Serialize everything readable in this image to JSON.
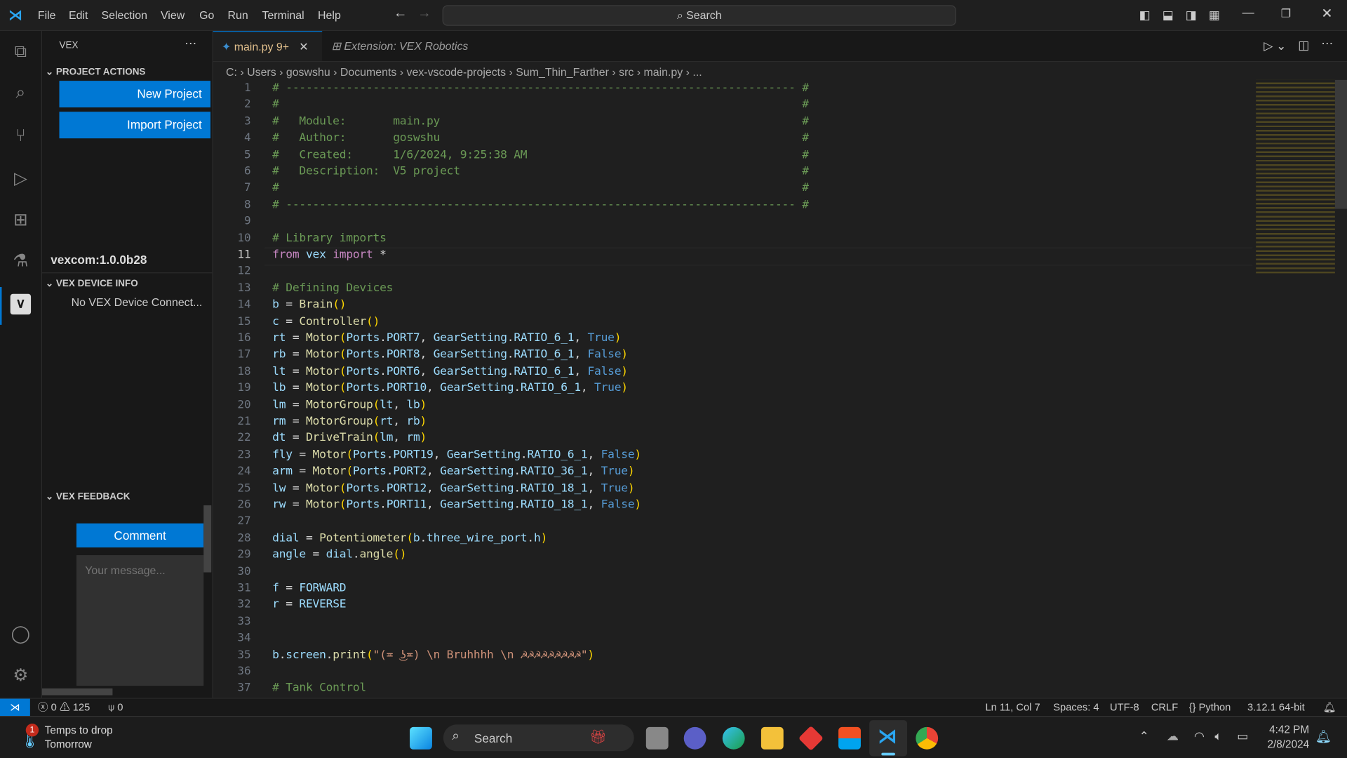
{
  "menu": [
    "File",
    "Edit",
    "Selection",
    "View",
    "Go",
    "Run",
    "Terminal",
    "Help"
  ],
  "search_label": "Search",
  "sidebar": {
    "title": "VEX",
    "project_actions": "PROJECT ACTIONS",
    "new_project": "New Project",
    "import_project": "Import Project",
    "version": "vexcom:1.0.0b28",
    "device_info": "VEX DEVICE INFO",
    "no_device": "No VEX Device Connect...",
    "feedback": "VEX FEEDBACK",
    "comment": "Comment",
    "message_placeholder": "Your message..."
  },
  "tabs": [
    {
      "label": "main.py",
      "badge": "9+"
    },
    {
      "label": "Extension: VEX Robotics"
    }
  ],
  "breadcrumb": [
    "C:",
    "Users",
    "goswshu",
    "Documents",
    "vex-vscode-projects",
    "Sum_Thin_Farther",
    "src",
    "main.py",
    "..."
  ],
  "code": [
    "# ---------------------------------------------------------------------------- #",
    "#                                                                              #",
    "#   Module:       main.py                                                      #",
    "#   Author:       goswshu                                                      #",
    "#   Created:      1/6/2024, 9:25:38 AM                                         #",
    "#   Description:  V5 project                                                   #",
    "#                                                                              #",
    "# ---------------------------------------------------------------------------- #",
    "",
    "# Library imports",
    "from vex import *",
    "",
    "# Defining Devices",
    "b = Brain()",
    "c = Controller()",
    "rt = Motor(Ports.PORT7, GearSetting.RATIO_6_1, True)",
    "rb = Motor(Ports.PORT8, GearSetting.RATIO_6_1, False)",
    "lt = Motor(Ports.PORT6, GearSetting.RATIO_6_1, False)",
    "lb = Motor(Ports.PORT10, GearSetting.RATIO_6_1, True)",
    "lm = MotorGroup(lt, lb)",
    "rm = MotorGroup(rt, rb)",
    "dt = DriveTrain(lm, rm)",
    "fly = Motor(Ports.PORT19, GearSetting.RATIO_6_1, False)",
    "arm = Motor(Ports.PORT2, GearSetting.RATIO_36_1, True)",
    "lw = Motor(Ports.PORT12, GearSetting.RATIO_18_1, True)",
    "rw = Motor(Ports.PORT11, GearSetting.RATIO_18_1, False)",
    "",
    "dial = Potentiometer(b.three_wire_port.h)",
    "angle = dial.angle()",
    "",
    "f = FORWARD",
    "r = REVERSE",
    "",
    "",
    "b.screen.print(\"(≖ ͜ʖ≖) \\n Bruhhhh \\n ☭☭☭☭☭☭☭☭☭\")",
    "",
    "# Tank Control"
  ],
  "status": {
    "errors": "0",
    "warnings": "125",
    "ports": "0",
    "position": "Ln 11, Col 7",
    "spaces": "Spaces: 4",
    "encoding": "UTF-8",
    "eol": "CRLF",
    "language": "Python",
    "interpreter": "3.12.1 64-bit"
  },
  "taskbar": {
    "weather_line1": "Temps to drop",
    "weather_line2": "Tomorrow",
    "weather_badge": "1",
    "search": "Search",
    "time": "4:42 PM",
    "date": "2/8/2024"
  },
  "colors": {
    "accent": "#0078d4",
    "background": "#1f1f1f"
  }
}
